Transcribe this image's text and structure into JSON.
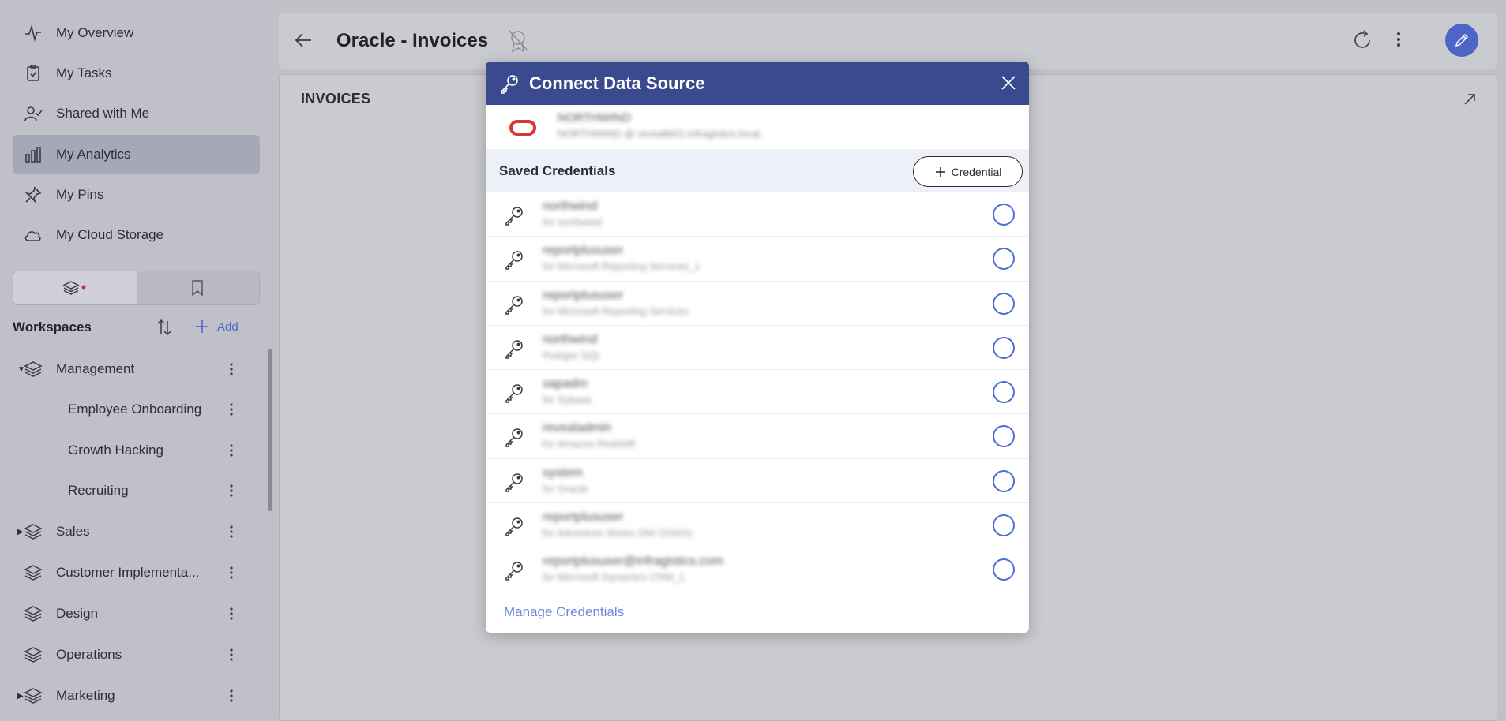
{
  "sidebar": {
    "nav": [
      {
        "label": "My Overview",
        "icon": "activity-icon"
      },
      {
        "label": "My Tasks",
        "icon": "task-icon"
      },
      {
        "label": "Shared with Me",
        "icon": "shared-user-icon"
      },
      {
        "label": "My Analytics",
        "icon": "analytics-icon",
        "active": true
      },
      {
        "label": "My Pins",
        "icon": "pin-icon"
      },
      {
        "label": "My Cloud Storage",
        "icon": "cloud-icon"
      }
    ],
    "workspaces_title": "Workspaces",
    "add_label": "Add",
    "workspaces": [
      {
        "label": "Management",
        "expanded": true
      },
      {
        "label": "Employee Onboarding",
        "child": true
      },
      {
        "label": "Growth Hacking",
        "child": true
      },
      {
        "label": "Recruiting",
        "child": true
      },
      {
        "label": "Sales",
        "expanded": false
      },
      {
        "label": "Customer Implementa..."
      },
      {
        "label": "Design"
      },
      {
        "label": "Operations"
      },
      {
        "label": "Marketing",
        "expanded": false
      }
    ]
  },
  "header": {
    "title": "Oracle - Invoices"
  },
  "panel": {
    "title": "INVOICES"
  },
  "modal": {
    "title": "Connect Data Source",
    "source": {
      "name": "NORTHWIND",
      "detail": "NORTHWIND @ revealbi01.infragistics.local"
    },
    "saved_title": "Saved Credentials",
    "add_credential_label": "Credential",
    "credentials": [
      {
        "name": "northwind",
        "sub": "for northwind"
      },
      {
        "name": "reportplususer",
        "sub": "for Microsoft Reporting Services_1"
      },
      {
        "name": "reportplususer",
        "sub": "for Microsoft Reporting Services"
      },
      {
        "name": "northwind",
        "sub": "Postgre SQL"
      },
      {
        "name": "sapadm",
        "sub": "for Sybase"
      },
      {
        "name": "revealadmin",
        "sub": "for Amazon Redshift"
      },
      {
        "name": "system",
        "sub": "for Oracle"
      },
      {
        "name": "reportplususer",
        "sub": "for Adventure Works DW (SSAS)"
      },
      {
        "name": "reportplususer@infragistics.com",
        "sub": "for Microsoft Dynamics CRM_1"
      }
    ],
    "manage_label": "Manage Credentials"
  },
  "colors": {
    "accent": "#4d66c6",
    "modal_header": "#3b4a8e",
    "oracle_logo": "#d43a2f",
    "link": "#6f88db"
  }
}
